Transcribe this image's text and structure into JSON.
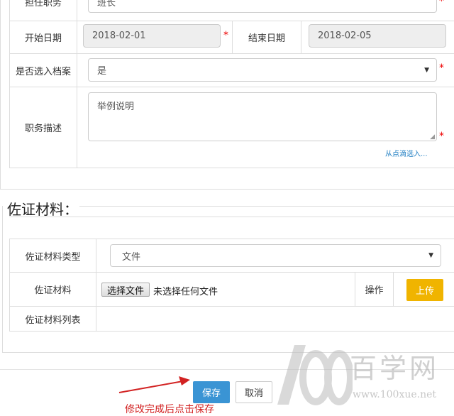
{
  "position": {
    "label": "担任职务",
    "value": "班长"
  },
  "start_date": {
    "label": "开始日期",
    "value": "2018-02-01"
  },
  "end_date": {
    "label": "结束日期",
    "value": "2018-02-05"
  },
  "archive": {
    "label": "是否选入档案",
    "value": "是"
  },
  "description": {
    "label": "职务描述",
    "value": "举例说明",
    "link": "从点滴选入..."
  },
  "required_mark": "*",
  "evidence": {
    "section_title": "佐证材料：",
    "type_label": "佐证材料类型",
    "type_value": "文件",
    "material_label": "佐证材料",
    "choose_file": "选择文件",
    "no_file": "未选择任何文件",
    "operation_label": "操作",
    "upload": "上传",
    "list_label": "佐证材料列表"
  },
  "actions": {
    "save": "保存",
    "cancel": "取消"
  },
  "annotation": "修改完成后点击保存",
  "watermark": {
    "brand": "百学网",
    "url": "www.100xue.net"
  },
  "colors": {
    "required": "#ee0000",
    "upload": "#f0b400",
    "save": "#3a94d4",
    "link": "#1a7bc1",
    "annotation": "#d22222"
  }
}
